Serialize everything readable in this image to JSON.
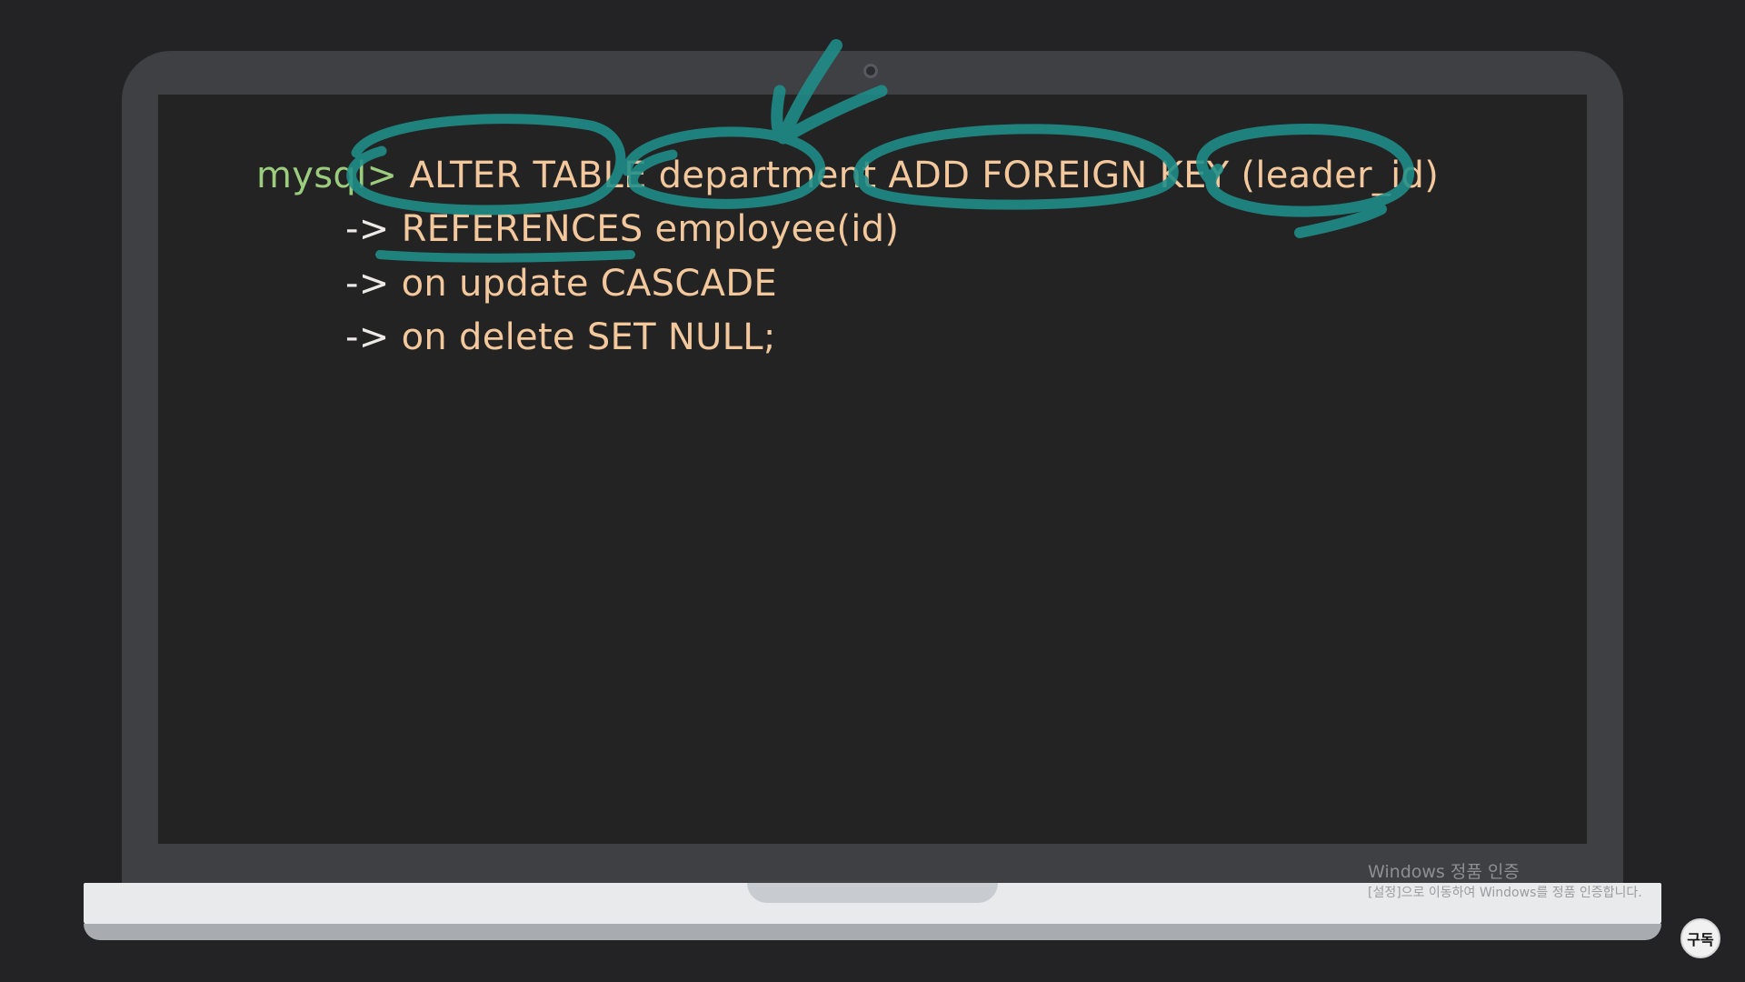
{
  "terminal": {
    "prompt": "mysql>",
    "line1_command": "ALTER TABLE department ADD FOREIGN KEY (leader_id)",
    "continuation_arrow": "->",
    "line2_command": "REFERENCES employee(id)",
    "line3_command": "on update CASCADE",
    "line4_command": "on delete SET NULL;"
  },
  "watermark": {
    "title": "Windows 정품 인증",
    "subtitle": "[설정]으로 이동하여 Windows를 정품 인증합니다."
  },
  "subscribe": {
    "label": "구독"
  },
  "colors": {
    "prompt": "#9ccc7e",
    "command": "#f3c89d",
    "arrow": "#eceae6",
    "annotation": "#1f8f8a",
    "bezel": "#3e4044",
    "screen": "#232324"
  }
}
